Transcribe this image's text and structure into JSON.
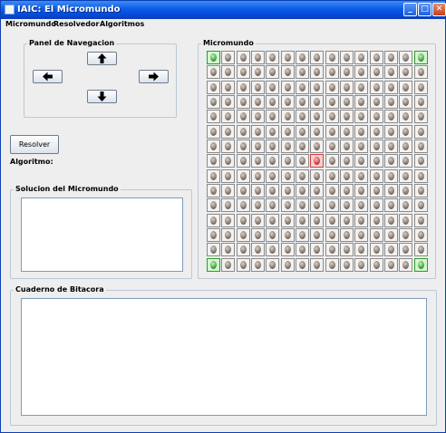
{
  "window": {
    "title": "IAIC: El Micromundo",
    "minimize": "_",
    "maximize": "□",
    "close": "✕"
  },
  "menubar": [
    "Micromundo",
    "Resolvedor",
    "Algoritmos"
  ],
  "navigation_panel": {
    "title": "Panel de Navegacion",
    "up_icon": "arrow-up-icon",
    "left_icon": "arrow-left-icon",
    "right_icon": "arrow-right-icon",
    "down_icon": "arrow-down-icon"
  },
  "resolver": {
    "button_label": "Resolver",
    "algorithm_label": "Algoritmo:"
  },
  "solution_panel": {
    "title": "Solucion del Micromundo",
    "value": ""
  },
  "micromundo": {
    "title": "Micromundo",
    "rows": 15,
    "cols": 15,
    "corner_cells": [
      [
        0,
        0
      ],
      [
        0,
        14
      ],
      [
        14,
        0
      ],
      [
        14,
        14
      ]
    ],
    "agent_cell": [
      7,
      7
    ]
  },
  "log_panel": {
    "title": "Cuaderno de Bitacora",
    "value": ""
  }
}
